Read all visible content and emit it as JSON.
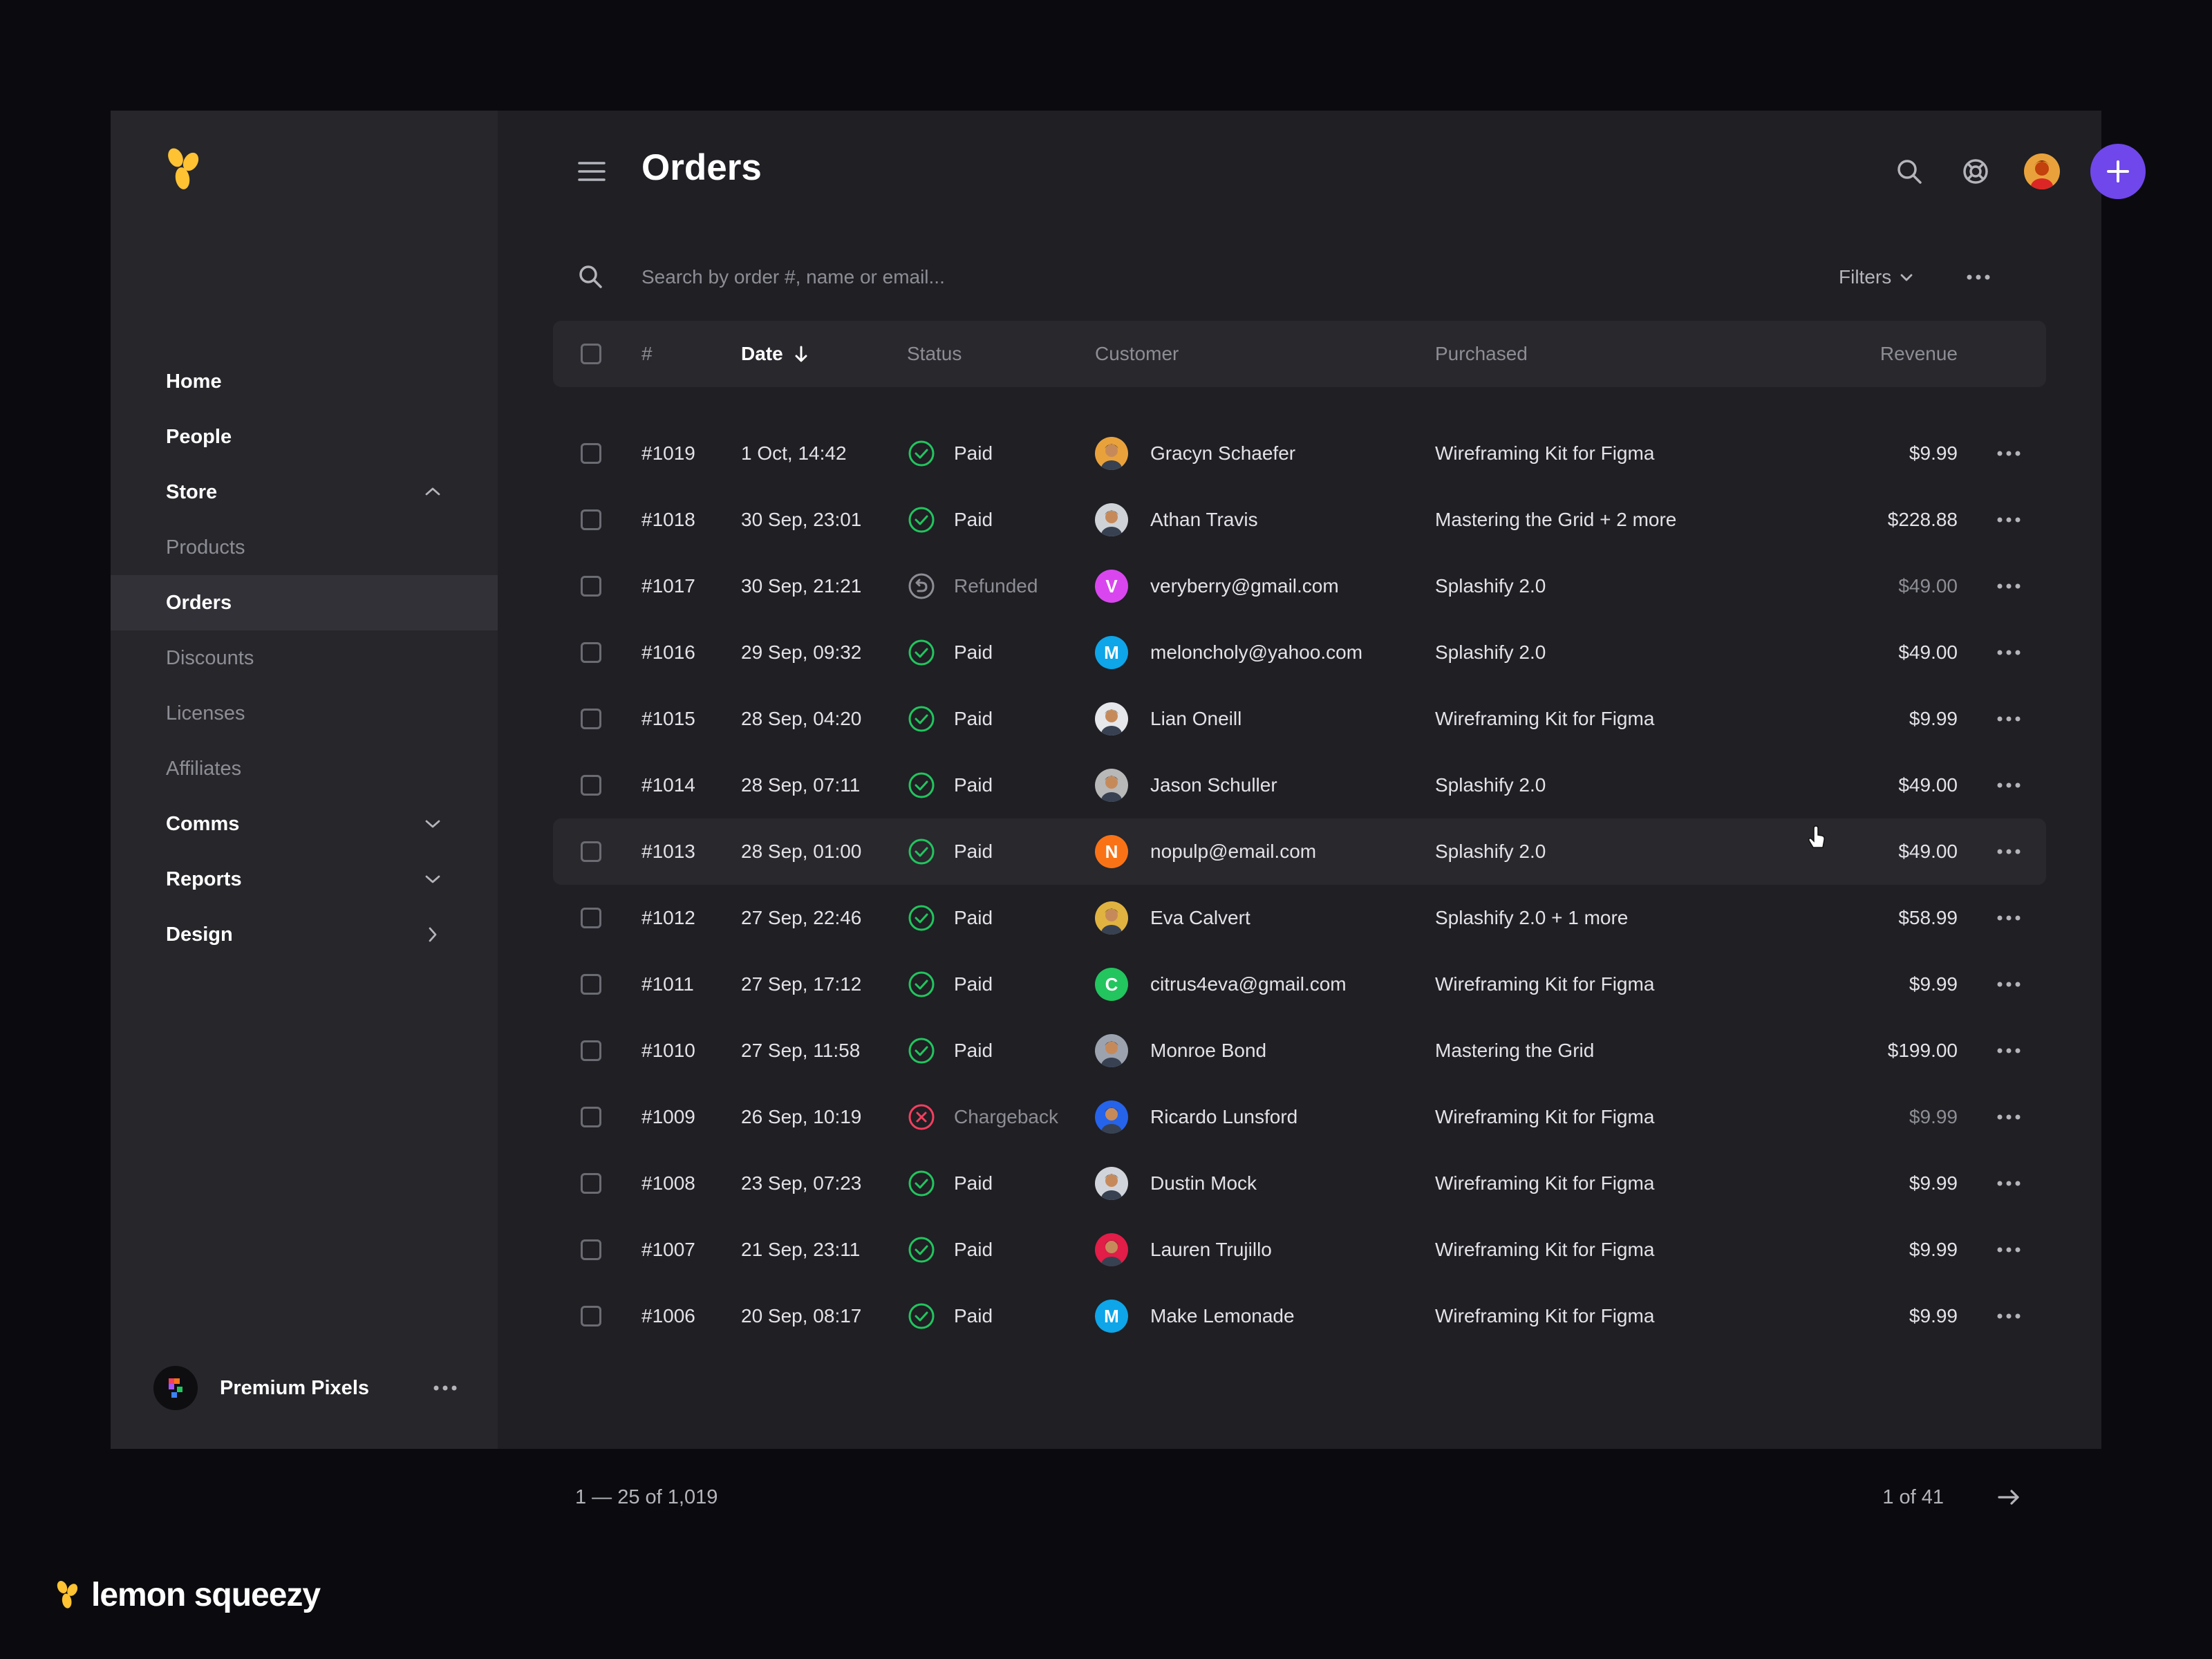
{
  "sidebar": {
    "nav": [
      {
        "label": "Home",
        "kind": "top"
      },
      {
        "label": "People",
        "kind": "top"
      },
      {
        "label": "Store",
        "kind": "top",
        "chevron": "up"
      },
      {
        "label": "Products",
        "kind": "sub"
      },
      {
        "label": "Orders",
        "kind": "sub",
        "active": true
      },
      {
        "label": "Discounts",
        "kind": "sub"
      },
      {
        "label": "Licenses",
        "kind": "sub"
      },
      {
        "label": "Affiliates",
        "kind": "sub"
      },
      {
        "label": "Comms",
        "kind": "top",
        "chevron": "down"
      },
      {
        "label": "Reports",
        "kind": "top",
        "chevron": "down"
      },
      {
        "label": "Design",
        "kind": "top",
        "chevron": "right"
      }
    ],
    "workspace": {
      "name": "Premium Pixels"
    }
  },
  "header": {
    "title": "Orders",
    "icons": [
      "menu-icon",
      "search-icon",
      "support-icon",
      "avatar",
      "plus-icon"
    ],
    "accent": "#7047eb"
  },
  "search": {
    "placeholder": "Search by order #, name or email...",
    "filters_label": "Filters"
  },
  "table": {
    "columns": {
      "number": "#",
      "date": "Date",
      "status": "Status",
      "customer": "Customer",
      "purchased": "Purchased",
      "revenue": "Revenue"
    },
    "rows": [
      {
        "id": "#1019",
        "date": "1 Oct, 14:42",
        "status": "Paid",
        "customer": "Gracyn Schaefer",
        "avatar": {
          "type": "photo",
          "color": "#e9a23b"
        },
        "purchased": "Wireframing Kit for Figma",
        "revenue": "$9.99"
      },
      {
        "id": "#1018",
        "date": "30 Sep, 23:01",
        "status": "Paid",
        "customer": "Athan Travis",
        "avatar": {
          "type": "photo",
          "color": "#cfd3d8"
        },
        "purchased": "Mastering the Grid + 2 more",
        "revenue": "$228.88"
      },
      {
        "id": "#1017",
        "date": "30 Sep, 21:21",
        "status": "Refunded",
        "customer": "veryberry@gmail.com",
        "avatar": {
          "type": "initial",
          "letter": "V",
          "color": "#d946ef"
        },
        "purchased": "Splashify 2.0",
        "revenue": "$49.00"
      },
      {
        "id": "#1016",
        "date": "29 Sep, 09:32",
        "status": "Paid",
        "customer": "meloncholy@yahoo.com",
        "avatar": {
          "type": "initial",
          "letter": "M",
          "color": "#0ea5e9"
        },
        "purchased": "Splashify 2.0",
        "revenue": "$49.00"
      },
      {
        "id": "#1015",
        "date": "28 Sep, 04:20",
        "status": "Paid",
        "customer": "Lian Oneill",
        "avatar": {
          "type": "photo",
          "color": "#e5e7eb"
        },
        "purchased": "Wireframing Kit for Figma",
        "revenue": "$9.99"
      },
      {
        "id": "#1014",
        "date": "28 Sep, 07:11",
        "status": "Paid",
        "customer": "Jason Schuller",
        "avatar": {
          "type": "photo",
          "color": "#b8b8b8"
        },
        "purchased": "Splashify 2.0",
        "revenue": "$49.00"
      },
      {
        "id": "#1013",
        "date": "28 Sep, 01:00",
        "status": "Paid",
        "customer": "nopulp@email.com",
        "avatar": {
          "type": "initial",
          "letter": "N",
          "color": "#f97316"
        },
        "purchased": "Splashify 2.0",
        "revenue": "$49.00"
      },
      {
        "id": "#1012",
        "date": "27 Sep, 22:46",
        "status": "Paid",
        "customer": "Eva Calvert",
        "avatar": {
          "type": "photo",
          "color": "#e0b341"
        },
        "purchased": "Splashify 2.0 + 1 more",
        "revenue": "$58.99"
      },
      {
        "id": "#1011",
        "date": "27 Sep, 17:12",
        "status": "Paid",
        "customer": "citrus4eva@gmail.com",
        "avatar": {
          "type": "initial",
          "letter": "C",
          "color": "#22c55e"
        },
        "purchased": "Wireframing Kit for Figma",
        "revenue": "$9.99"
      },
      {
        "id": "#1010",
        "date": "27 Sep, 11:58",
        "status": "Paid",
        "customer": "Monroe Bond",
        "avatar": {
          "type": "photo",
          "color": "#9ca3af"
        },
        "purchased": "Mastering the Grid",
        "revenue": "$199.00"
      },
      {
        "id": "#1009",
        "date": "26 Sep, 10:19",
        "status": "Chargeback",
        "customer": "Ricardo Lunsford",
        "avatar": {
          "type": "photo",
          "color": "#2563eb"
        },
        "purchased": "Wireframing Kit for Figma",
        "revenue": "$9.99"
      },
      {
        "id": "#1008",
        "date": "23 Sep, 07:23",
        "status": "Paid",
        "customer": "Dustin Mock",
        "avatar": {
          "type": "photo",
          "color": "#d1d5db"
        },
        "purchased": "Wireframing Kit for Figma",
        "revenue": "$9.99"
      },
      {
        "id": "#1007",
        "date": "21 Sep, 23:11",
        "status": "Paid",
        "customer": "Lauren Trujillo",
        "avatar": {
          "type": "photo",
          "color": "#e11d48"
        },
        "purchased": "Wireframing Kit for Figma",
        "revenue": "$9.99"
      },
      {
        "id": "#1006",
        "date": "20 Sep, 08:17",
        "status": "Paid",
        "customer": "Make Lemonade",
        "avatar": {
          "type": "initial",
          "letter": "M",
          "color": "#0ea5e9"
        },
        "purchased": "Wireframing Kit for Figma",
        "revenue": "$9.99"
      }
    ]
  },
  "footer": {
    "range": "1 — 25 of 1,019",
    "page": "1 of 41"
  },
  "brand": {
    "name": "lemon squeezy"
  },
  "colors": {
    "paid": "#22c55e",
    "refunded": "#8d8d95",
    "chargeback": "#f43f5e"
  }
}
